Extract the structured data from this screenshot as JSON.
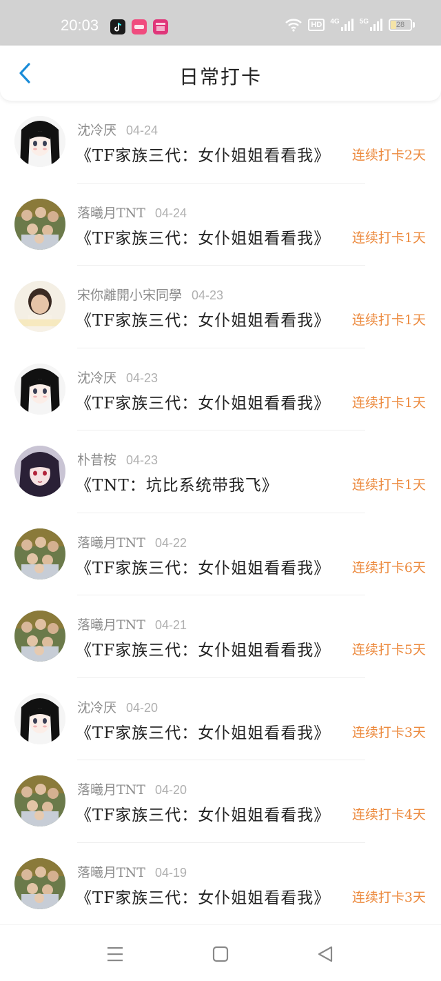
{
  "status_bar": {
    "time": "20:03",
    "hd_label": "HD",
    "net1_label": "4G",
    "net2_label": "5G",
    "battery_level": "28",
    "app_icons": [
      "tiktok-icon",
      "app-pink-icon",
      "app-magenta-icon"
    ]
  },
  "header": {
    "title": "日常打卡",
    "back_icon": "chevron-left-icon"
  },
  "colors": {
    "accent": "#ec8a3e",
    "back": "#1a8cd8",
    "status_bar_bg": "#d2d2d2"
  },
  "records": [
    {
      "user": "沈冷厌",
      "date": "04-24",
      "book": "《TF家族三代：女仆姐姐看看我》",
      "streak": "连续打卡2天",
      "avatar": "anime-girl-1"
    },
    {
      "user": "落曦月TNT",
      "date": "04-24",
      "book": "《TF家族三代：女仆姐姐看看我》",
      "streak": "连续打卡1天",
      "avatar": "group-photo"
    },
    {
      "user": "宋你離開小宋同學",
      "date": "04-23",
      "book": "《TF家族三代：女仆姐姐看看我》",
      "streak": "连续打卡1天",
      "avatar": "boy-photo"
    },
    {
      "user": "沈冷厌",
      "date": "04-23",
      "book": "《TF家族三代：女仆姐姐看看我》",
      "streak": "连续打卡1天",
      "avatar": "anime-girl-1"
    },
    {
      "user": "朴昔桉",
      "date": "04-23",
      "book": "《TNT：坑比系统带我飞》",
      "streak": "连续打卡1天",
      "avatar": "anime-girl-2"
    },
    {
      "user": "落曦月TNT",
      "date": "04-22",
      "book": "《TF家族三代：女仆姐姐看看我》",
      "streak": "连续打卡6天",
      "avatar": "group-photo"
    },
    {
      "user": "落曦月TNT",
      "date": "04-21",
      "book": "《TF家族三代：女仆姐姐看看我》",
      "streak": "连续打卡5天",
      "avatar": "group-photo"
    },
    {
      "user": "沈冷厌",
      "date": "04-20",
      "book": "《TF家族三代：女仆姐姐看看我》",
      "streak": "连续打卡3天",
      "avatar": "anime-girl-1"
    },
    {
      "user": "落曦月TNT",
      "date": "04-20",
      "book": "《TF家族三代：女仆姐姐看看我》",
      "streak": "连续打卡4天",
      "avatar": "group-photo"
    },
    {
      "user": "落曦月TNT",
      "date": "04-19",
      "book": "《TF家族三代：女仆姐姐看看我》",
      "streak": "连续打卡3天",
      "avatar": "group-photo"
    }
  ],
  "nav_bar": {
    "items": [
      "menu-icon",
      "home-square-icon",
      "back-triangle-icon"
    ]
  }
}
